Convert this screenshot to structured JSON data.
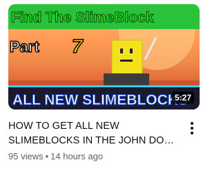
{
  "video": {
    "thumbnail": {
      "top_text": "Find The SlimeBlock",
      "part_text": "Part",
      "part_number": "7",
      "bottom_text": "ALL NEW SLIMEBLOCKS",
      "colors": {
        "top_text": "#2ee82e",
        "part_text": "#ffffff",
        "part_number": "#ffd21a",
        "bottom_text": "#ffffff",
        "bottom_bar": "#1a1a2e"
      }
    },
    "duration": "5:27",
    "title_line_1": "HOW TO GET ALL NEW",
    "title_line_2": "SLIMEBLOCKS IN THE JOHN DO…",
    "views": "95 views",
    "separator": "•",
    "age": "14 hours ago",
    "menu_icon": "more-vertical-icon"
  }
}
